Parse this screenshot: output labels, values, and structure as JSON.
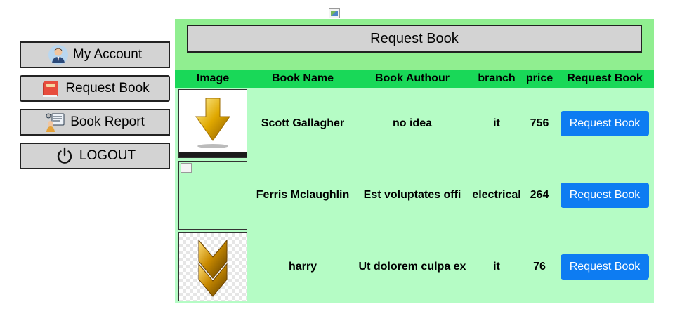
{
  "header": {
    "broken_image_icon": "broken-image-icon"
  },
  "sidebar": {
    "items": [
      {
        "label": "My Account",
        "icon": "user-avatar-icon"
      },
      {
        "label": "Request Book",
        "icon": "book-icon"
      },
      {
        "label": "Book Report",
        "icon": "report-icon"
      },
      {
        "label": "LOGOUT",
        "icon": "power-icon"
      }
    ]
  },
  "main": {
    "title_button": "Request Book",
    "table": {
      "headers": [
        "Image",
        "Book Name",
        "Book Authour",
        "branch",
        "price",
        "Request Book"
      ],
      "rows": [
        {
          "image": "gold-down-arrow",
          "name": "Scott Gallagher",
          "author": "no idea",
          "branch": "it",
          "price": "756",
          "action": "Request Book"
        },
        {
          "image": "broken-image",
          "name": "Ferris Mclaughlin",
          "author": "Est voluptates offi",
          "branch": "electrical",
          "price": "264",
          "action": "Request Book"
        },
        {
          "image": "gold-chevron",
          "name": "harry",
          "author": "Ut dolorem culpa ex",
          "branch": "it",
          "price": "76",
          "action": "Request Book"
        }
      ]
    }
  },
  "colors": {
    "panel_bg": "#b5fcc5",
    "panel_top_bg": "#90ee90",
    "table_header_bg": "#19d858",
    "button_primary": "#0d7cf2",
    "sidebar_button_bg": "#d3d3d3"
  }
}
